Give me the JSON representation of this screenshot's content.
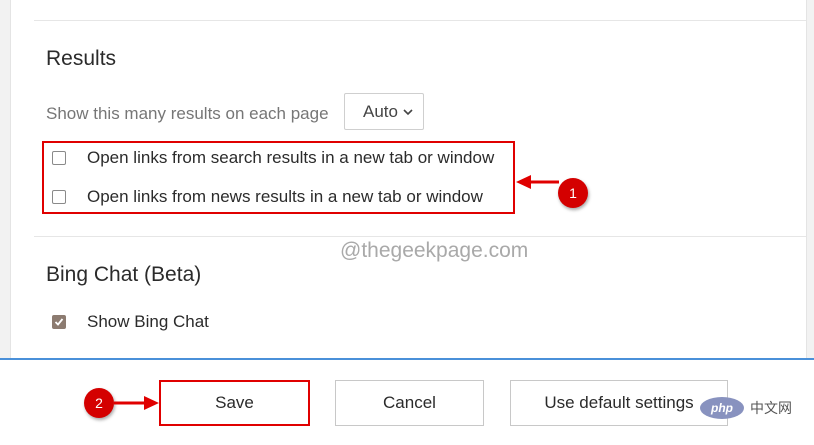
{
  "results": {
    "title": "Results",
    "per_page_label": "Show this many results on each page",
    "per_page_value": "Auto",
    "options": [
      {
        "label": "Open links from search results in a new tab or window",
        "checked": false
      },
      {
        "label": "Open links from news results in a new tab or window",
        "checked": false
      }
    ]
  },
  "bing_chat": {
    "title": "Bing Chat (Beta)",
    "show_label": "Show Bing Chat",
    "show_checked": true
  },
  "watermark": "@thegeekpage.com",
  "annotations": {
    "step1": "1",
    "step2": "2"
  },
  "footer": {
    "save_label": "Save",
    "cancel_label": "Cancel",
    "default_label": "Use default settings"
  },
  "php_logo": {
    "mark": "php",
    "text": "中文网"
  },
  "colors": {
    "annotation_red": "#e00000",
    "footer_border": "#4a90d9",
    "checkbox_checked": "#8c7b70"
  }
}
